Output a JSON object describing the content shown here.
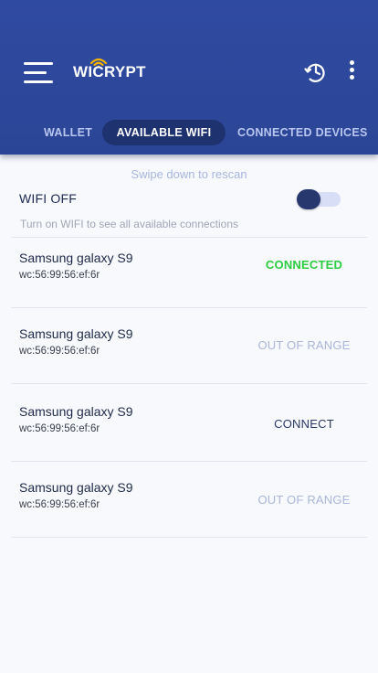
{
  "header": {
    "logo_text": "WICRYPT",
    "tabs": [
      {
        "label": "WALLET"
      },
      {
        "label": "AVAILABLE  WIFI"
      },
      {
        "label": "CONNECTED DEVICES"
      }
    ],
    "icons": {
      "menu": "menu-icon",
      "history": "history-clock-icon",
      "more": "more-vertical-icon",
      "logo": "wifi-logo-icon"
    }
  },
  "content": {
    "swipe_hint": "Swipe down to rescan",
    "wifi_toggle": {
      "label": "WIFI OFF",
      "hint": "Turn on WIFI to see all available connections",
      "state": "off"
    },
    "networks": [
      {
        "name": "Samsung galaxy S9",
        "mac": "wc:56:99:56:ef:6r",
        "status": "CONNECTED"
      },
      {
        "name": "Samsung galaxy S9",
        "mac": "wc:56:99:56:ef:6r",
        "status": "OUT OF RANGE"
      },
      {
        "name": "Samsung galaxy S9",
        "mac": "wc:56:99:56:ef:6r",
        "status": "CONNECT"
      },
      {
        "name": "Samsung galaxy S9",
        "mac": "wc:56:99:56:ef:6r",
        "status": "OUT OF RANGE"
      }
    ]
  },
  "colors": {
    "header_bg": "#2f4aa1",
    "active_tab_bg": "#1f3270",
    "connected": "#2ecc40",
    "out_of_range": "#aab6da",
    "connect": "#2a3866"
  }
}
